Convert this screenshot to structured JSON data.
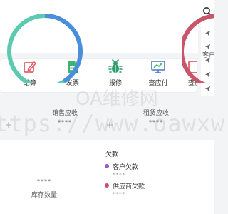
{
  "header": {
    "search_icon": "search-icon"
  },
  "actions": [
    {
      "label": "结算",
      "icon": "edit-icon",
      "color": "#e35d6a"
    },
    {
      "label": "发票",
      "icon": "invoice-icon",
      "color": "#3cb371"
    },
    {
      "label": "报修",
      "icon": "bug-icon",
      "color": "#2e9e6e"
    },
    {
      "label": "查应付",
      "icon": "monitor-chart-icon",
      "color": "#4f79c6"
    },
    {
      "label": "查应",
      "icon": "document-icon",
      "color": "#e35d6a"
    }
  ],
  "side_menu": {
    "icon": "send-icon",
    "count": 5
  },
  "summary": {
    "sales_receivable": {
      "title": "销售应收",
      "value": "****"
    },
    "rental_receivable": {
      "title": "租赁应收",
      "value": "****"
    }
  },
  "watermark": {
    "line1": "OA维修网",
    "line2": "ttps://www.oawxw.ne"
  },
  "inventory": {
    "value": "****",
    "label": "库存数量",
    "colors": {
      "left": "#5ccab0",
      "right": "#4a8fdc"
    }
  },
  "debts": {
    "title": "欠款",
    "items": [
      {
        "name": "客户欠款",
        "value": "****",
        "color": "#9b59d0"
      },
      {
        "name": "供应商欠款",
        "value": "****",
        "color": "#d0506a"
      }
    ]
  },
  "customer_ring": {
    "label": "客户",
    "color": "#c7566b"
  }
}
